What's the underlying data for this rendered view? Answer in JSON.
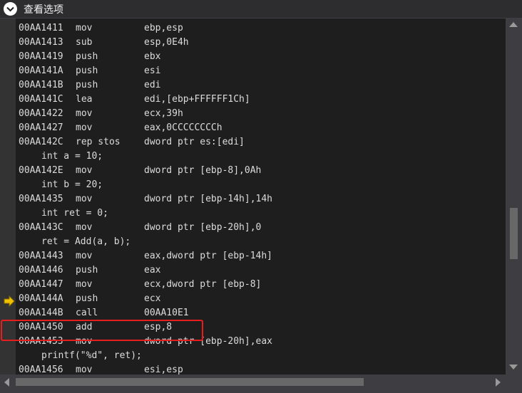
{
  "window": {
    "title": "查看选项"
  },
  "colors": {
    "background": "#1e1e1e",
    "text": "#dcdcdc",
    "highlight_border": "#e81e1e",
    "arrow": "#f2c200"
  },
  "lines": [
    {
      "type": "asm",
      "addr": "00AA1410",
      "mnemonic": "push",
      "operands": "ebp"
    },
    {
      "type": "asm",
      "addr": "00AA1411",
      "mnemonic": "mov",
      "operands": "ebp,esp"
    },
    {
      "type": "asm",
      "addr": "00AA1413",
      "mnemonic": "sub",
      "operands": "esp,0E4h"
    },
    {
      "type": "asm",
      "addr": "00AA1419",
      "mnemonic": "push",
      "operands": "ebx"
    },
    {
      "type": "asm",
      "addr": "00AA141A",
      "mnemonic": "push",
      "operands": "esi"
    },
    {
      "type": "asm",
      "addr": "00AA141B",
      "mnemonic": "push",
      "operands": "edi"
    },
    {
      "type": "asm",
      "addr": "00AA141C",
      "mnemonic": "lea",
      "operands": "edi,[ebp+FFFFFF1Ch]"
    },
    {
      "type": "asm",
      "addr": "00AA1422",
      "mnemonic": "mov",
      "operands": "ecx,39h"
    },
    {
      "type": "asm",
      "addr": "00AA1427",
      "mnemonic": "mov",
      "operands": "eax,0CCCCCCCCh"
    },
    {
      "type": "asm",
      "addr": "00AA142C",
      "mnemonic": "rep stos",
      "operands": "dword ptr es:[edi]"
    },
    {
      "type": "src",
      "text": "int a = 10;"
    },
    {
      "type": "asm",
      "addr": "00AA142E",
      "mnemonic": "mov",
      "operands": "dword ptr [ebp-8],0Ah"
    },
    {
      "type": "src",
      "text": "int b = 20;"
    },
    {
      "type": "asm",
      "addr": "00AA1435",
      "mnemonic": "mov",
      "operands": "dword ptr [ebp-14h],14h"
    },
    {
      "type": "src",
      "text": "int ret = 0;"
    },
    {
      "type": "asm",
      "addr": "00AA143C",
      "mnemonic": "mov",
      "operands": "dword ptr [ebp-20h],0"
    },
    {
      "type": "src",
      "text": "ret = Add(a, b);"
    },
    {
      "type": "asm",
      "addr": "00AA1443",
      "mnemonic": "mov",
      "operands": "eax,dword ptr [ebp-14h]"
    },
    {
      "type": "asm",
      "addr": "00AA1446",
      "mnemonic": "push",
      "operands": "eax"
    },
    {
      "type": "asm",
      "addr": "00AA1447",
      "mnemonic": "mov",
      "operands": "ecx,dword ptr [ebp-8]"
    },
    {
      "type": "asm",
      "addr": "00AA144A",
      "mnemonic": "push",
      "operands": "ecx"
    },
    {
      "type": "asm",
      "addr": "00AA144B",
      "mnemonic": "call",
      "operands": "00AA10E1"
    },
    {
      "type": "asm",
      "addr": "00AA1450",
      "mnemonic": "add",
      "operands": "esp,8"
    },
    {
      "type": "asm",
      "addr": "00AA1453",
      "mnemonic": "mov",
      "operands": "dword ptr [ebp-20h],eax"
    },
    {
      "type": "src",
      "text": "printf(\"%d\", ret);"
    },
    {
      "type": "asm",
      "addr": "00AA1456",
      "mnemonic": "mov",
      "operands": "esi,esp"
    }
  ],
  "current_instruction_index": 20,
  "highlighted_instruction_index": 22,
  "icons": {
    "title": "chevron-down-icon",
    "current": "current-instruction-arrow-icon"
  }
}
